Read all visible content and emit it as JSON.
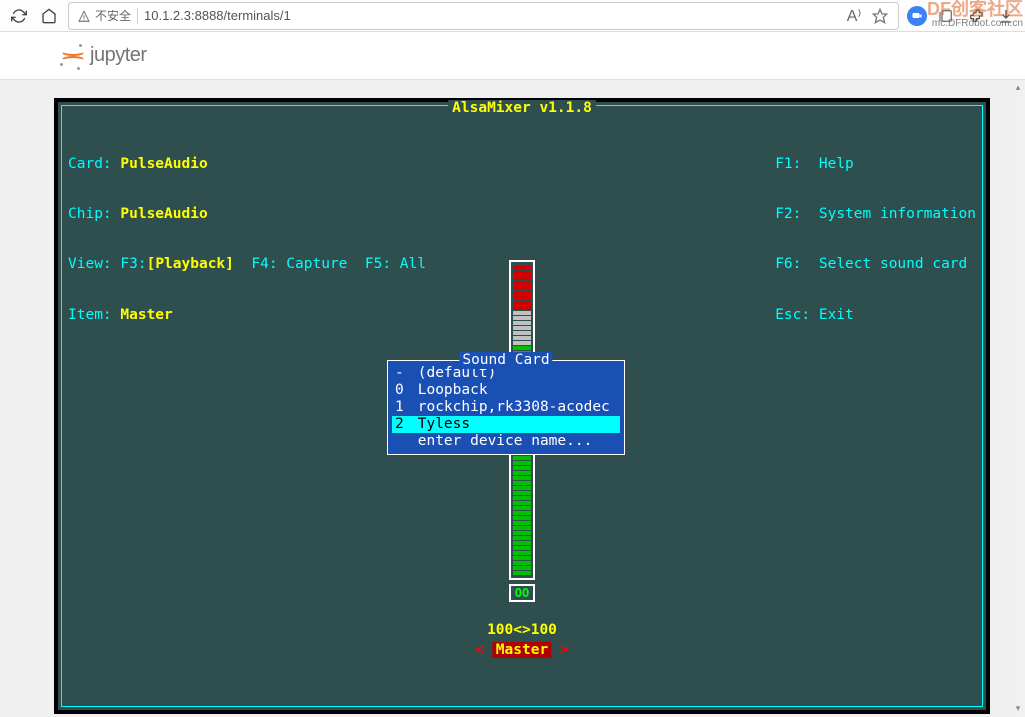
{
  "browser": {
    "insecure_label": "不安全",
    "url": "10.1.2.3:8888/terminals/1",
    "read_aloud": "A⁾"
  },
  "watermark": {
    "main": "DF创客社区",
    "sub": "mc.DFRobot.com.cn"
  },
  "jupyter": {
    "name": "jupyter"
  },
  "alsamixer": {
    "title": "AlsaMixer v1.1.8",
    "card_label": "Card:",
    "card_value": "PulseAudio",
    "chip_label": "Chip:",
    "chip_value": "PulseAudio",
    "view_label": "View:",
    "view_f3": "F3:",
    "view_f3v": "[Playback]",
    "view_f4": "F4: Capture",
    "view_f5": "F5: All",
    "item_label": "Item:",
    "item_value": "Master",
    "help": {
      "f1k": "F1:",
      "f1v": "Help",
      "f2k": "F2:",
      "f2v": "System information",
      "f6k": "F6:",
      "f6v": "Select sound card",
      "esck": "Esc:",
      "escv": "Exit"
    },
    "level": "100<>100",
    "mute": "OO",
    "channel": "Master",
    "arrow_l": "<",
    "arrow_r": ">"
  },
  "dialog": {
    "title": "Sound Card",
    "rows": [
      {
        "idx": "-",
        "name": "(default)",
        "selected": false
      },
      {
        "idx": "0",
        "name": "Loopback",
        "selected": false
      },
      {
        "idx": "1",
        "name": "rockchip,rk3308-acodec",
        "selected": false
      },
      {
        "idx": "2",
        "name": "Tyless",
        "selected": true
      },
      {
        "idx": " ",
        "name": "enter device name...",
        "selected": false
      }
    ]
  }
}
